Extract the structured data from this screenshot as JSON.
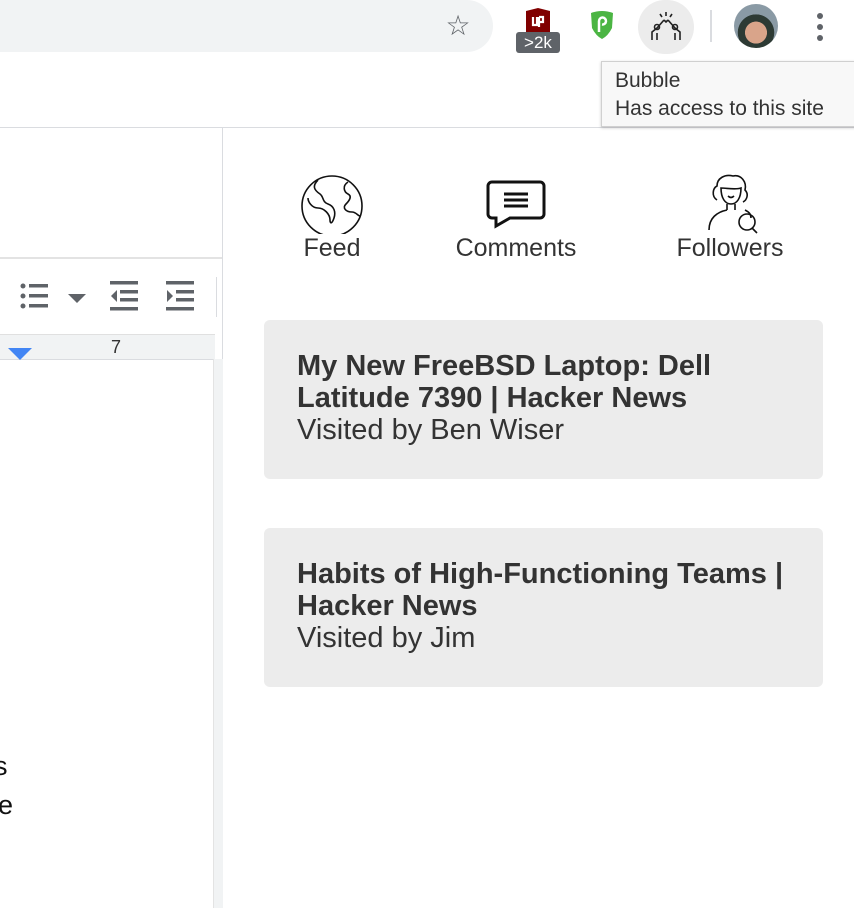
{
  "browser": {
    "extension_badge": ">2k",
    "tooltip": {
      "title": "Bubble",
      "subtitle": "Has access to this site"
    }
  },
  "docs": {
    "ruler_number": "7",
    "visible_text_fragments": [
      ".",
      "s",
      "e"
    ]
  },
  "bubble": {
    "nav": [
      {
        "label": "Feed",
        "icon": "globe-icon"
      },
      {
        "label": "Comments",
        "icon": "speech-bubble-icon"
      },
      {
        "label": "Followers",
        "icon": "person-search-icon"
      }
    ],
    "cards": [
      {
        "title": "My New FreeBSD Laptop: Dell Latitude 7390 | Hacker News",
        "visited_by": "Visited by Ben Wiser"
      },
      {
        "title": "Habits of High-Functioning Teams | Hacker News",
        "visited_by": "Visited by Jim"
      }
    ]
  }
}
